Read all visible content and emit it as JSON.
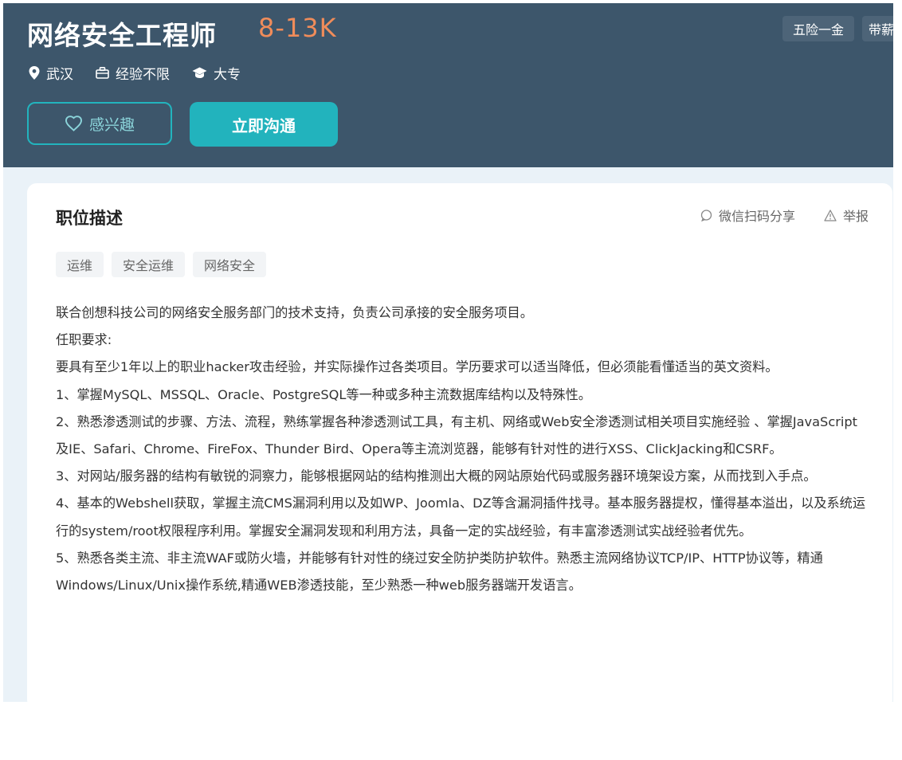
{
  "job": {
    "title": "网络安全工程师",
    "salary": "8-13K",
    "meta": {
      "location": "武汉",
      "experience": "经验不限",
      "education": "大专"
    },
    "benefits": [
      "五险一金",
      "带薪"
    ]
  },
  "actions": {
    "interest_label": "感兴趣",
    "chat_label": "立即沟通"
  },
  "description": {
    "section_title": "职位描述",
    "share_label": "微信扫码分享",
    "report_label": "举报",
    "tags": [
      "运维",
      "安全运维",
      "网络安全"
    ],
    "paragraphs": [
      "联合创想科技公司的网络安全服务部门的技术支持，负责公司承接的安全服务项目。",
      "任职要求:",
      "要具有至少1年以上的职业hacker攻击经验，并实际操作过各类项目。学历要求可以适当降低，但必须能看懂适当的英文资料。",
      "1、掌握MySQL、MSSQL、Oracle、PostgreSQL等一种或多种主流数据库结构以及特殊性。",
      "2、熟悉渗透测试的步骤、方法、流程，熟练掌握各种渗透测试工具，有主机、网络或Web安全渗透测试相关项目实施经验 、掌握JavaScript及IE、Safari、Chrome、FireFox、Thunder Bird、Opera等主流浏览器，能够有针对性的进行XSS、ClickJacking和CSRF。",
      "3、对网站/服务器的结构有敏锐的洞察力，能够根据网站的结构推测出大概的网站原始代码或服务器环境架设方案，从而找到入手点。",
      "4、基本的Webshell获取，掌握主流CMS漏洞利用以及如WP、Joomla、DZ等含漏洞插件找寻。基本服务器提权，懂得基本溢出，以及系统运行的system/root权限程序利用。掌握安全漏洞发现和利用方法，具备一定的实战经验，有丰富渗透测试实战经验者优先。",
      "5、熟悉各类主流、非主流WAF或防火墙，并能够有针对性的绕过安全防护类防护软件。熟悉主流网络协议TCP/IP、HTTP协议等，精通Windows/Linux/Unix操作系统,精通WEB渗透技能，至少熟悉一种web服务器端开发语言。"
    ]
  },
  "colors": {
    "header_bg": "#3d566b",
    "accent": "#22b3bd",
    "salary": "#f08c5a"
  }
}
